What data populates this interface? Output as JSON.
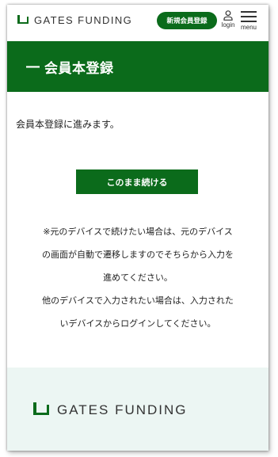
{
  "header": {
    "logo_text": "GATES FUNDING",
    "register_label": "新規会員登録",
    "login_label": "login",
    "menu_label": "menu"
  },
  "page": {
    "title_dash": "―",
    "title": "会員本登録"
  },
  "main": {
    "lead": "会員本登録に進みます。",
    "continue_label": "このまま続ける",
    "notes": [
      "※元のデバイスで続けたい場合は、元のデバイス",
      "の画面が自動で遷移しますのでそちらから入力を",
      "進めてください。",
      "他のデバイスで入力されたい場合は、入力された",
      "いデバイスからログインしてください。"
    ]
  },
  "footer": {
    "logo_text": "GATES FUNDING"
  },
  "colors": {
    "brand_green": "#0b6b1b",
    "footer_bg": "#ecf6f3"
  },
  "icons": [
    "logo-mark-icon",
    "user-icon",
    "hamburger-menu-icon"
  ]
}
